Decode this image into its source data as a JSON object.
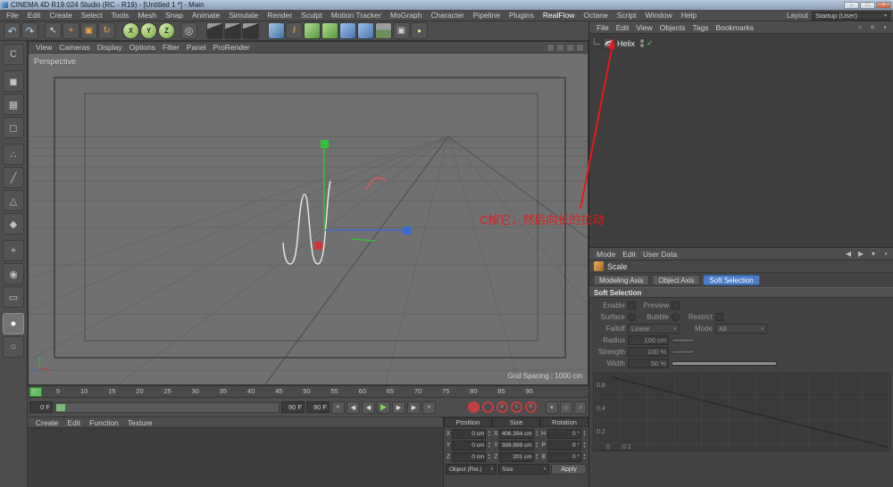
{
  "window": {
    "title": "CINEMA 4D R19.024 Studio (RC - R19) - [Untitled 1 *] - Main",
    "controls": {
      "minimize": "–",
      "maximize": "□",
      "close": "×"
    }
  },
  "menu_bar": {
    "items": [
      "File",
      "Edit",
      "Create",
      "Select",
      "Tools",
      "Mesh",
      "Snap",
      "Animate",
      "Simulate",
      "Render",
      "Sculpt",
      "Motion Tracker",
      "MoGraph",
      "Character",
      "Pipeline",
      "Plugins",
      "RealFlow",
      "Octane",
      "Script",
      "Window",
      "Help"
    ],
    "layout_label": "Layout",
    "layout_value": "Startup (User)"
  },
  "toolbar": {
    "icons": [
      {
        "name": "undo-icon",
        "glyph": "↶"
      },
      {
        "name": "redo-icon",
        "glyph": "↷"
      },
      {
        "name": "live-selection-icon",
        "glyph": "↖"
      },
      {
        "name": "move-tool-icon",
        "glyph": "+"
      },
      {
        "name": "scale-tool-icon",
        "glyph": "▣"
      },
      {
        "name": "rotate-tool-icon",
        "glyph": "↻"
      },
      {
        "name": "x-axis-lock-button",
        "glyph": "X"
      },
      {
        "name": "y-axis-lock-button",
        "glyph": "Y"
      },
      {
        "name": "z-axis-lock-button",
        "glyph": "Z"
      },
      {
        "name": "coordinate-system-button",
        "glyph": "◎"
      },
      {
        "name": "render-view-button",
        "glyph": ""
      },
      {
        "name": "render-picture-viewer-button",
        "glyph": ""
      },
      {
        "name": "render-settings-button",
        "glyph": ""
      },
      {
        "name": "add-cube-button",
        "glyph": ""
      },
      {
        "name": "spline-pen-button",
        "glyph": "/"
      },
      {
        "name": "subdivision-surface-button",
        "glyph": ""
      },
      {
        "name": "generators-button",
        "glyph": ""
      },
      {
        "name": "cloth-button",
        "glyph": ""
      },
      {
        "name": "simulate-button",
        "glyph": ""
      },
      {
        "name": "floor-button",
        "glyph": ""
      },
      {
        "name": "camera-button",
        "glyph": "▣"
      },
      {
        "name": "light-button",
        "glyph": "●"
      }
    ]
  },
  "left_toolbar": {
    "icons": [
      {
        "name": "make-editable-icon",
        "glyph": "C"
      },
      {
        "name": "model-mode-icon",
        "glyph": "◼"
      },
      {
        "name": "texture-mode-icon",
        "glyph": "▦"
      },
      {
        "name": "workplane-mode-icon",
        "glyph": "◻"
      },
      {
        "name": "points-mode-icon",
        "glyph": "∴"
      },
      {
        "name": "edges-mode-icon",
        "glyph": "╱"
      },
      {
        "name": "polygons-mode-icon",
        "glyph": "△"
      },
      {
        "name": "tweak-mode-icon",
        "glyph": "◆"
      },
      {
        "name": "enable-axis-icon",
        "glyph": "+"
      },
      {
        "name": "snap-icon",
        "glyph": "◉"
      },
      {
        "name": "workplane-icon",
        "glyph": "▭"
      },
      {
        "name": "lock-icon",
        "glyph": "●"
      },
      {
        "name": "viewport-solo-icon",
        "glyph": "○"
      }
    ]
  },
  "viewport": {
    "menus": [
      "View",
      "Cameras",
      "Display",
      "Options",
      "Filter",
      "Panel",
      "ProRender"
    ],
    "label": "Perspective",
    "grid_spacing": "Grid Spacing : 1000 cm",
    "corner_icons": [
      {
        "name": "pan-view-icon"
      },
      {
        "name": "zoom-view-icon"
      },
      {
        "name": "rotate-view-icon"
      },
      {
        "name": "switch-view-icon"
      }
    ]
  },
  "timeline": {
    "ticks": [
      "0",
      "5",
      "10",
      "15",
      "20",
      "25",
      "30",
      "35",
      "40",
      "45",
      "50",
      "55",
      "60",
      "65",
      "70",
      "75",
      "80",
      "85",
      "90"
    ]
  },
  "transport": {
    "current_frame": "0 F",
    "range_end": "90 F",
    "end_frame": "90 F",
    "buttons": [
      {
        "name": "goto-start-button",
        "glyph": "«"
      },
      {
        "name": "prev-key-button",
        "glyph": "◀"
      },
      {
        "name": "prev-frame-button",
        "glyph": "◀"
      },
      {
        "name": "play-button",
        "glyph": "▶"
      },
      {
        "name": "next-frame-button",
        "glyph": "▶"
      },
      {
        "name": "next-key-button",
        "glyph": "▶"
      },
      {
        "name": "goto-end-button",
        "glyph": "»"
      }
    ],
    "record_buttons": [
      {
        "name": "record-keyframe-button",
        "glyph": ""
      },
      {
        "name": "autokey-button",
        "glyph": ""
      },
      {
        "name": "record-position-toggle",
        "glyph": "P"
      },
      {
        "name": "record-scale-toggle",
        "glyph": "S"
      },
      {
        "name": "record-rotation-toggle",
        "glyph": "R"
      }
    ],
    "option_icons": [
      {
        "name": "keyframe-selection-icon",
        "glyph": "▾"
      },
      {
        "name": "pla-icon",
        "glyph": "◇"
      },
      {
        "name": "sound-icon",
        "glyph": "♪"
      }
    ]
  },
  "materials": {
    "menus": [
      "Create",
      "Edit",
      "Function",
      "Texture"
    ]
  },
  "coordinates": {
    "headers": [
      "Position",
      "Size",
      "Rotation"
    ],
    "position": [
      {
        "axis": "X",
        "value": "0 cm"
      },
      {
        "axis": "Y",
        "value": "0 cm"
      },
      {
        "axis": "Z",
        "value": "0 cm"
      }
    ],
    "size": [
      {
        "axis": "X",
        "value": "406.394 cm"
      },
      {
        "axis": "Y",
        "value": "399.999 cm"
      },
      {
        "axis": "Z",
        "value": "201 cm"
      }
    ],
    "rotation": [
      {
        "axis": "H",
        "value": "0 °"
      },
      {
        "axis": "P",
        "value": "0 °"
      },
      {
        "axis": "B",
        "value": "0 °"
      }
    ],
    "mode_dropdown": "Object (Rel.)",
    "size_dropdown": "Size",
    "apply_label": "Apply"
  },
  "object_manager": {
    "menus": [
      "File",
      "Edit",
      "View",
      "Objects",
      "Tags",
      "Bookmarks"
    ],
    "corner_icons": [
      {
        "name": "search-icon",
        "glyph": "○"
      },
      {
        "name": "filter-icon",
        "glyph": "≡"
      },
      {
        "name": "lock-icon",
        "glyph": "▪"
      }
    ],
    "objects": [
      {
        "name": "Helix",
        "enabled_check": "✓"
      }
    ]
  },
  "attributes": {
    "menus": [
      "Mode",
      "Edit",
      "User Data"
    ],
    "corner_icons": [
      {
        "name": "back-icon",
        "glyph": "◀"
      },
      {
        "name": "forward-icon",
        "glyph": "▶"
      },
      {
        "name": "history-icon",
        "glyph": "▾"
      },
      {
        "name": "lock-icon",
        "glyph": "▪"
      }
    ],
    "tool_title": "Scale",
    "tabs": [
      {
        "label": "Modeling Axis"
      },
      {
        "label": "Object Axis"
      },
      {
        "label": "Soft Selection"
      }
    ],
    "section": "Soft Selection",
    "enable_label": "Enable",
    "preview_label": "Preview",
    "surface_label": "Surface",
    "bubble_label": "Bubble",
    "restrict_label": "Restrict",
    "falloff_label": "Falloff",
    "falloff_value": "Linear",
    "mode_label": "Mode",
    "mode_value": "All",
    "radius_label": "Radius",
    "radius_value": "100 cm",
    "strength_label": "Strength",
    "strength_value": "100 %",
    "width_label": "Width",
    "width_value": "50 %",
    "graph": {
      "y_ticks": [
        "0.8",
        "0.4",
        "0.2"
      ],
      "x_ticks": [
        "0",
        "0.1"
      ]
    }
  },
  "annotation": {
    "text": "C掉它，然后向长的拉动",
    "color": "#e41b1b"
  },
  "colors": {
    "active_tab": "#4a7cc7",
    "play_green": "#79d84f",
    "record_red": "#c24040",
    "axis_green": "#35c135",
    "axis_blue": "#3a6ad4",
    "axis_red": "#d23535",
    "playhead_green": "#5fbf5f"
  }
}
